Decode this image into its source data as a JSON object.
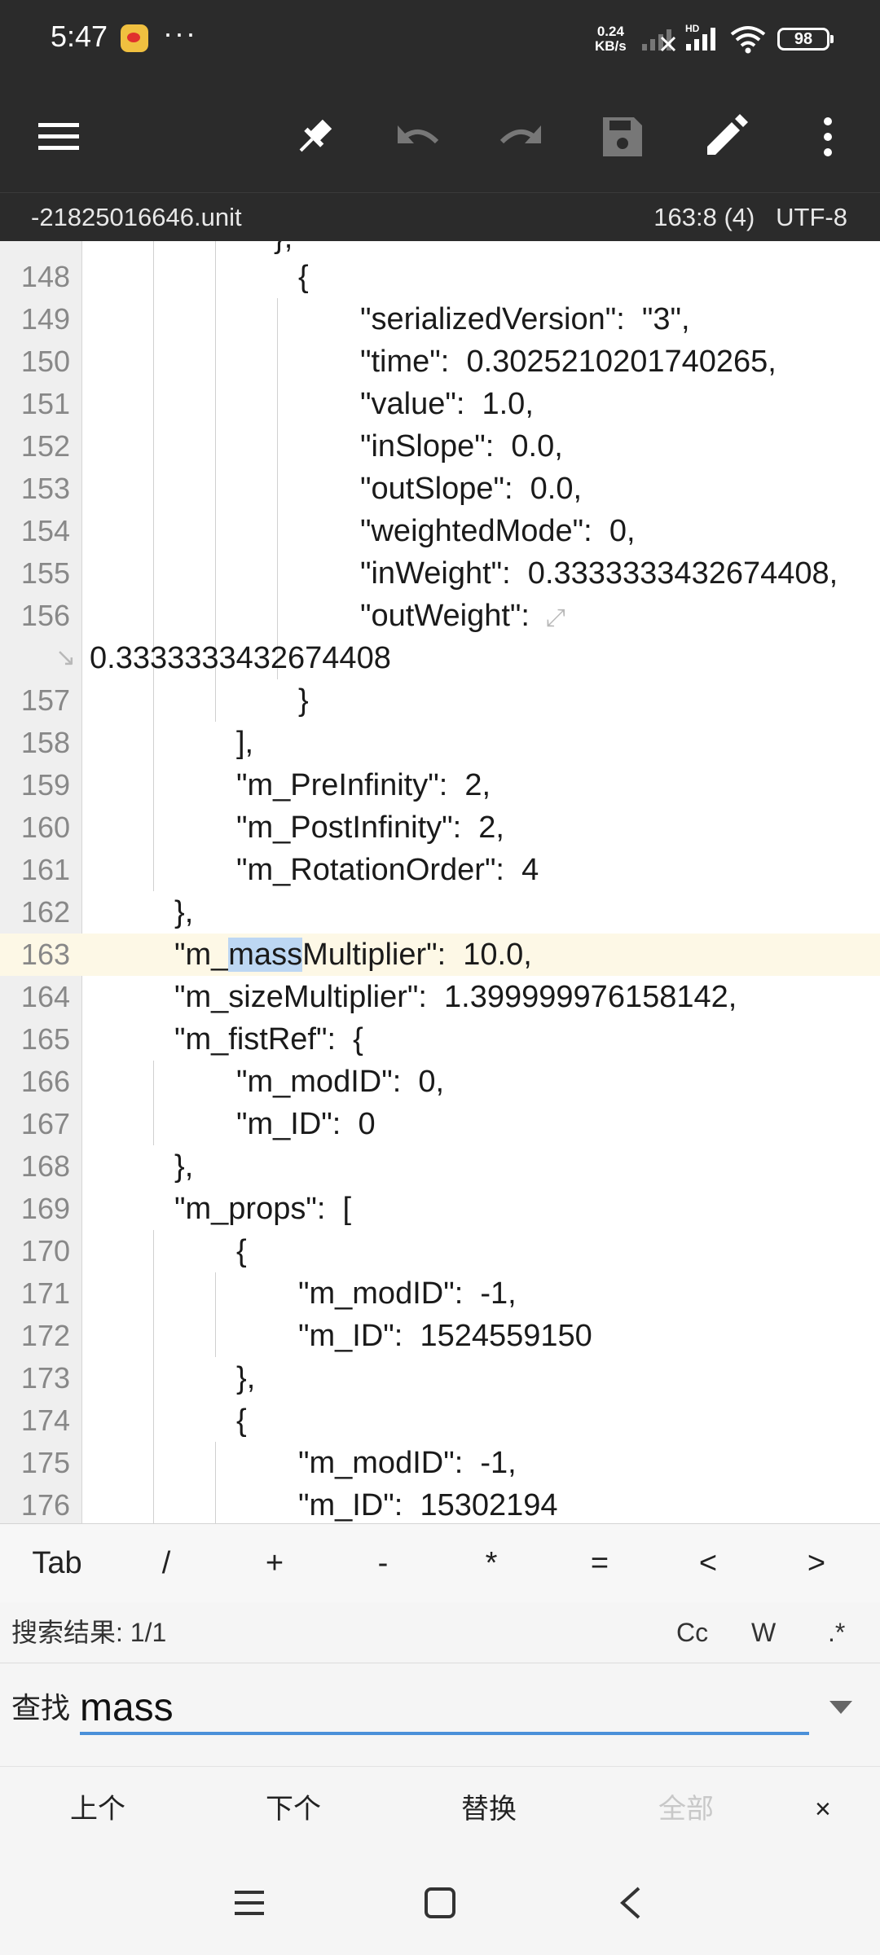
{
  "status_bar": {
    "time": "5:47",
    "more": "···",
    "net_speed_value": "0.24",
    "net_speed_unit": "KB/s",
    "signal_hd_label": "HD",
    "battery": "98",
    "icons": [
      "weibo-icon",
      "more-icon",
      "signal-icon",
      "hd-signal-icon",
      "wifi-icon",
      "battery-icon"
    ]
  },
  "toolbar": {
    "icons": [
      "menu-icon",
      "pin-icon",
      "undo-icon",
      "redo-icon",
      "save-icon",
      "edit-icon",
      "overflow-icon"
    ]
  },
  "info_bar": {
    "filename": "-21825016646.unit",
    "position": "163:8 (4)",
    "encoding": "UTF-8"
  },
  "editor": {
    "top_partial_text": "},",
    "lines": [
      {
        "num": "148",
        "indent": 3,
        "text": "{"
      },
      {
        "num": "149",
        "indent": 4,
        "text": "\"serializedVersion\":  \"3\","
      },
      {
        "num": "150",
        "indent": 4,
        "text": "\"time\":  0.3025210201740265,"
      },
      {
        "num": "151",
        "indent": 4,
        "text": "\"value\":  1.0,"
      },
      {
        "num": "152",
        "indent": 4,
        "text": "\"inSlope\":  0.0,"
      },
      {
        "num": "153",
        "indent": 4,
        "text": "\"outSlope\":  0.0,"
      },
      {
        "num": "154",
        "indent": 4,
        "text": "\"weightedMode\":  0,"
      },
      {
        "num": "155",
        "indent": 4,
        "text": "\"inWeight\":  0.3333333432674408,"
      },
      {
        "num": "156",
        "indent": 4,
        "text": "\"outWeight\":"
      },
      {
        "num": "",
        "indent": 0,
        "text": "0.3333333432674408"
      },
      {
        "num": "157",
        "indent": 3,
        "text": "}"
      },
      {
        "num": "158",
        "indent": 2,
        "text": "],"
      },
      {
        "num": "159",
        "indent": 2,
        "text": "\"m_PreInfinity\":  2,"
      },
      {
        "num": "160",
        "indent": 2,
        "text": "\"m_PostInfinity\":  2,"
      },
      {
        "num": "161",
        "indent": 2,
        "text": "\"m_RotationOrder\":  4"
      },
      {
        "num": "162",
        "indent": 1,
        "text": "},"
      },
      {
        "num": "163",
        "indent": 1,
        "text": "\"m_massMultiplier\":  10.0,",
        "active": true
      },
      {
        "num": "164",
        "indent": 1,
        "text": "\"m_sizeMultiplier\":  1.399999976158142,"
      },
      {
        "num": "165",
        "indent": 1,
        "text": "\"m_fistRef\":  {"
      },
      {
        "num": "166",
        "indent": 2,
        "text": "\"m_modID\":  0,"
      },
      {
        "num": "167",
        "indent": 2,
        "text": "\"m_ID\":  0"
      },
      {
        "num": "168",
        "indent": 1,
        "text": "},"
      },
      {
        "num": "169",
        "indent": 1,
        "text": "\"m_props\":  ["
      },
      {
        "num": "170",
        "indent": 2,
        "text": "{"
      },
      {
        "num": "171",
        "indent": 3,
        "text": "\"m_modID\":  -1,"
      },
      {
        "num": "172",
        "indent": 3,
        "text": "\"m_ID\":  1524559150"
      },
      {
        "num": "173",
        "indent": 2,
        "text": "},"
      },
      {
        "num": "174",
        "indent": 2,
        "text": "{"
      },
      {
        "num": "175",
        "indent": 3,
        "text": "\"m_modID\":  -1,"
      },
      {
        "num": "176",
        "indent": 3,
        "text": "\"m_ID\":  15302194"
      }
    ],
    "active_line": {
      "pre": "\"m_",
      "match": "mass",
      "post": "Multiplier\":  10.0,"
    },
    "accent_highlight": "#bdd7f3"
  },
  "symbol_bar": [
    "Tab",
    "/",
    "+",
    "-",
    "*",
    "=",
    "<",
    ">"
  ],
  "search": {
    "results_label": "搜索结果: 1/1",
    "options": [
      "Cc",
      "W",
      ".*"
    ],
    "find_label": "查找",
    "find_value": "mass",
    "accent_color": "#4a90d9"
  },
  "actions": {
    "prev": "上个",
    "next": "下个",
    "replace": "替换",
    "all": "全部",
    "close": "×"
  },
  "nav_bar": {
    "icons": [
      "recents-icon",
      "home-icon",
      "back-icon"
    ]
  }
}
